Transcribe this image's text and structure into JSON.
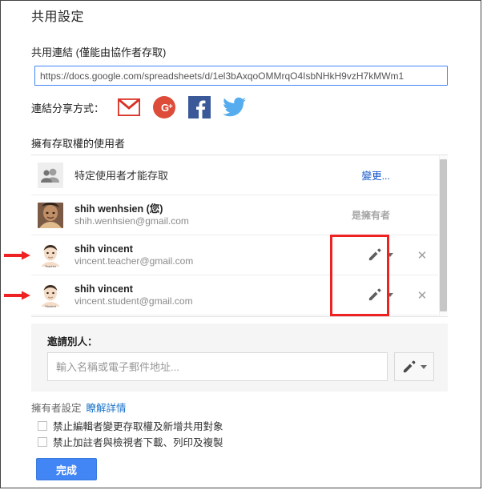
{
  "dialog": {
    "title": "共用設定"
  },
  "share_link": {
    "label": "共用連結 (僅能由協作者存取)",
    "url": "https://docs.google.com/spreadsheets/d/1el3bAxqoOMMrqO4IsbNHkH9vzH7kMWm1"
  },
  "social": {
    "label": "連結分享方式：",
    "items": [
      {
        "name": "gmail-icon",
        "title": "Gmail",
        "color": "#d93025"
      },
      {
        "name": "google-plus-icon",
        "title": "Google+",
        "color": "#dd4b39"
      },
      {
        "name": "facebook-icon",
        "title": "Facebook",
        "color": "#3b5998"
      },
      {
        "name": "twitter-icon",
        "title": "Twitter",
        "color": "#55acee"
      }
    ]
  },
  "access": {
    "section_title": "擁有存取權的使用者",
    "visibility_row": {
      "text": "特定使用者才能存取",
      "change_label": "變更..."
    },
    "people": [
      {
        "name": "shih wenhsien (您)",
        "email": "shih.wenhsien@gmail.com",
        "role_text": "是擁有者",
        "avatar_caption": ""
      },
      {
        "name": "shih vincent",
        "email": "vincent.teacher@gmail.com",
        "role_text": "",
        "avatar_caption": "Teacher"
      },
      {
        "name": "shih vincent",
        "email": "vincent.student@gmail.com",
        "role_text": "",
        "avatar_caption": "Student"
      }
    ]
  },
  "invite": {
    "label": "邀請別人：",
    "placeholder": "輸入名稱或電子郵件地址...",
    "value": ""
  },
  "owner_settings": {
    "label": "擁有者設定",
    "learn_more": "瞭解詳情",
    "checkboxes": [
      {
        "label": "禁止編輯者變更存取權及新增共用對象",
        "checked": false
      },
      {
        "label": "禁止加註者與檢視者下載、列印及複製",
        "checked": false
      }
    ]
  },
  "footer": {
    "done_label": "完成"
  },
  "annotations": {
    "highlight_color": "#ee2222",
    "arrow_color": "#ee2222"
  }
}
